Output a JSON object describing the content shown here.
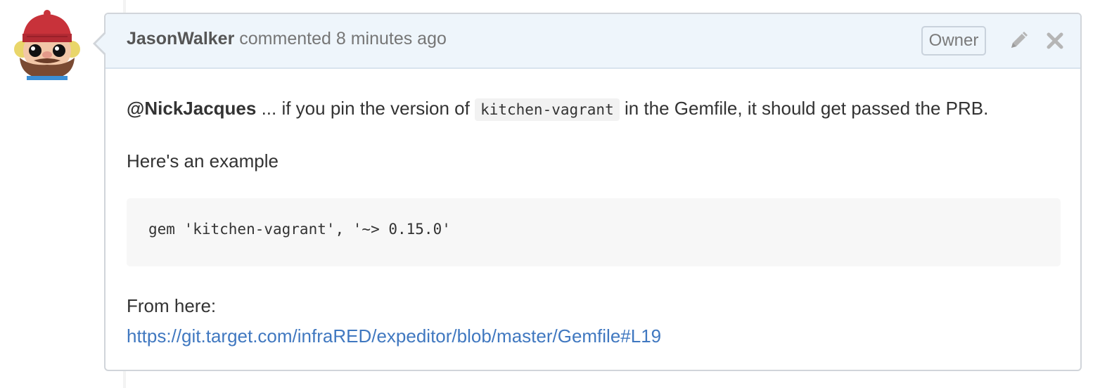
{
  "avatar": {
    "alt": "JasonWalker avatar"
  },
  "comment": {
    "author": "JasonWalker",
    "action": "commented",
    "time": "8 minutes ago",
    "badge": "Owner",
    "icons": {
      "edit": "pencil-icon",
      "delete": "close-icon"
    },
    "body": {
      "mention": "@NickJacques",
      "text_before_code": " ... if you pin the version of ",
      "inline_code": "kitchen-vagrant",
      "text_after_code": " in the Gemfile, it should get passed the PRB.",
      "example_intro": "Here's an example",
      "code_block": "gem 'kitchen-vagrant', '~> 0.15.0'",
      "from_here": "From here:",
      "link": "https://git.target.com/infraRED/expeditor/blob/master/Gemfile#L19"
    }
  },
  "colors": {
    "header_bg": "#eef5fb",
    "border": "#d1d5da",
    "link": "#4078c0",
    "code_bg": "#f7f7f7"
  }
}
